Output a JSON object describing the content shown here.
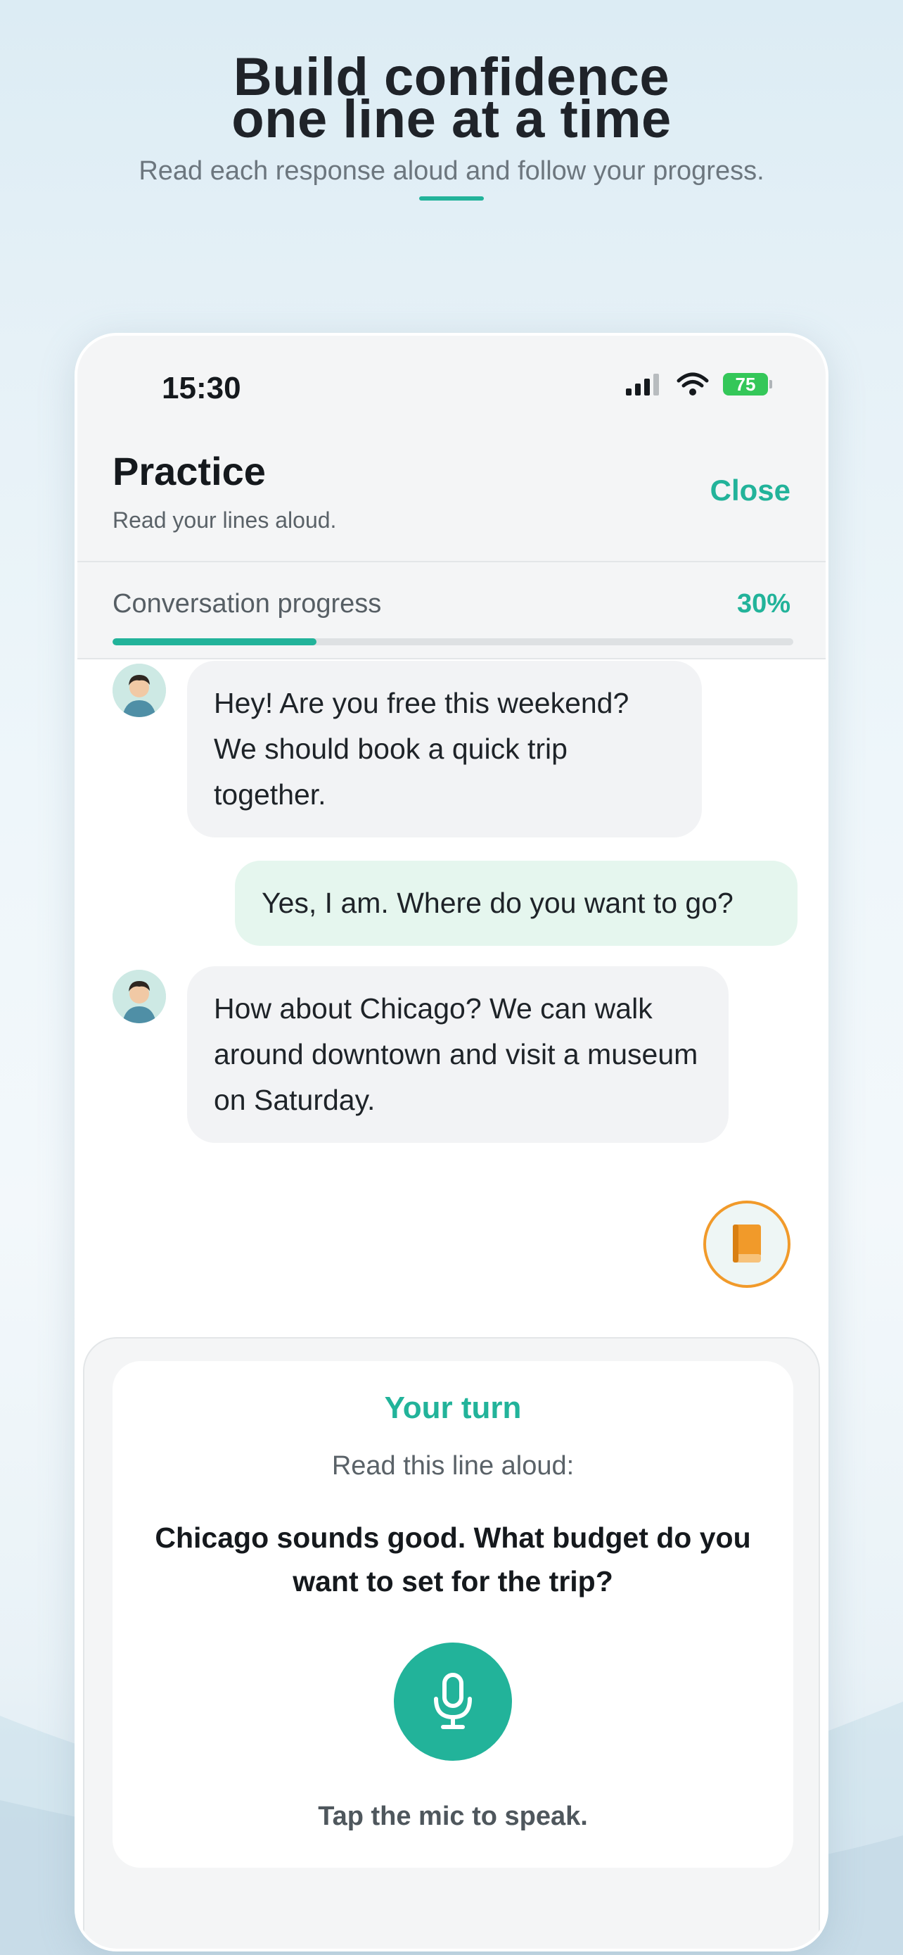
{
  "hero": {
    "title_line1": "Build confidence",
    "title_line2": "one line at a time",
    "subtitle": "Read each response aloud and follow your progress."
  },
  "status_bar": {
    "time": "15:30",
    "battery": "75"
  },
  "header": {
    "title": "Practice",
    "subtitle": "Read your lines aloud.",
    "close_label": "Close"
  },
  "progress": {
    "label": "Conversation progress",
    "percent_text": "30%",
    "value": 0.3
  },
  "messages": [
    {
      "sender": "partner",
      "text": "Hey! Are you free this weekend? We should book a quick trip together."
    },
    {
      "sender": "user",
      "text": "Yes, I am. Where do you want to go?"
    },
    {
      "sender": "partner",
      "text": "How about Chicago? We can walk around downtown and visit a museum on Saturday."
    }
  ],
  "turn": {
    "title": "Your turn",
    "instruction": "Read this line aloud:",
    "line": "Chicago sounds good. What budget do you want to set for the trip?",
    "hint": "Tap the mic to speak."
  },
  "colors": {
    "accent": "#22b39a",
    "book_accent": "#f19a2a",
    "user_bubble": "#e5f6ee",
    "partner_bubble": "#f2f3f5"
  },
  "icons": {
    "book": "book-icon",
    "mic": "mic-icon",
    "signal": "signal-icon",
    "wifi": "wifi-icon",
    "battery": "battery-icon",
    "avatar": "avatar"
  }
}
